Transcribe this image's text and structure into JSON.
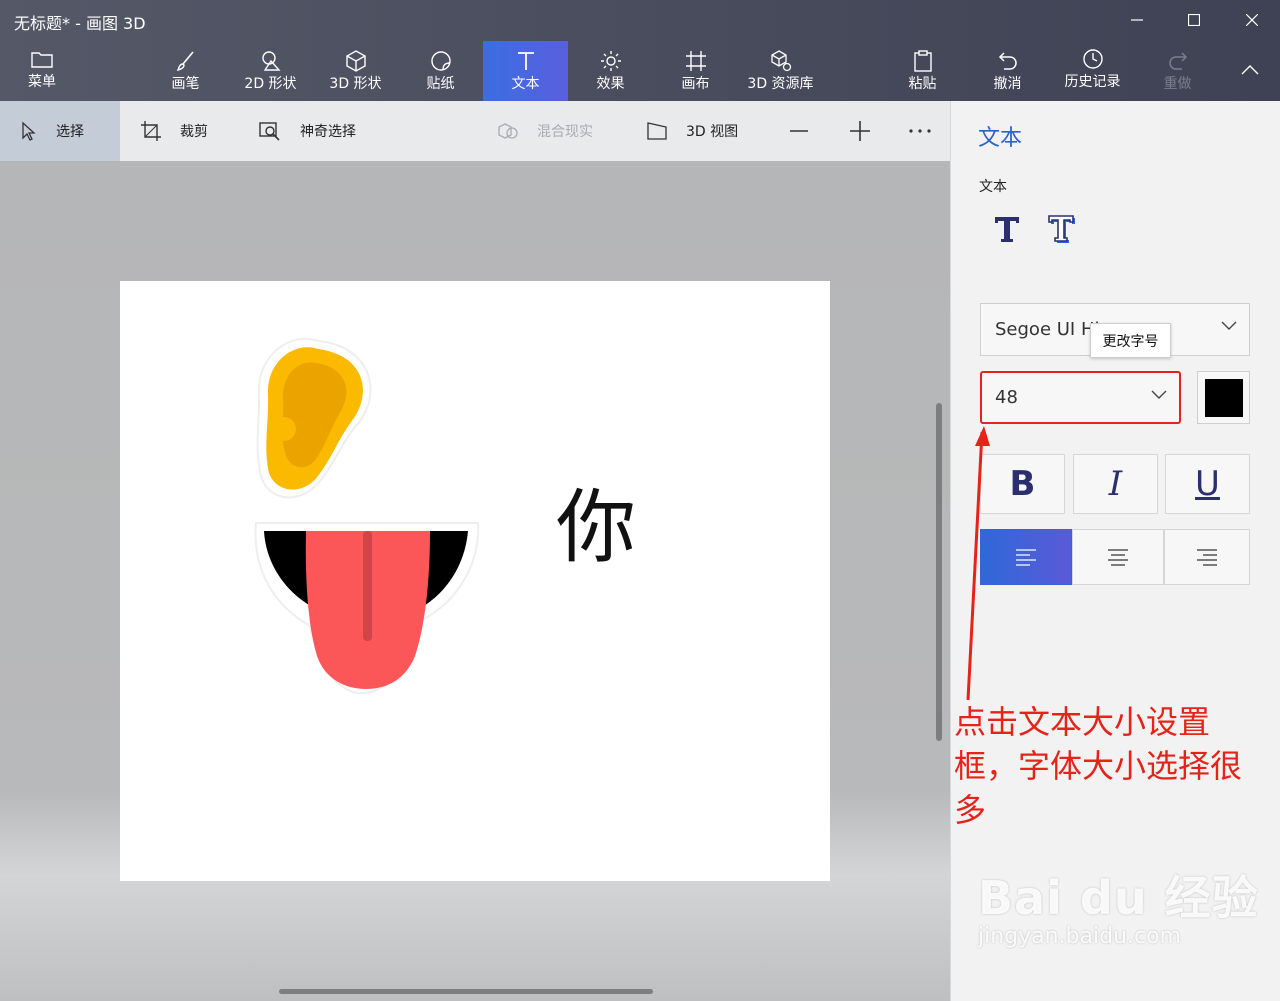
{
  "window": {
    "title": "无标题* - 画图 3D"
  },
  "ribbon": {
    "menu": "菜单",
    "tabs": [
      {
        "label": "画笔",
        "icon": "brush-icon"
      },
      {
        "label": "2D 形状",
        "icon": "2d-shapes-icon"
      },
      {
        "label": "3D 形状",
        "icon": "3d-shapes-icon"
      },
      {
        "label": "贴纸",
        "icon": "stickers-icon"
      },
      {
        "label": "文本",
        "icon": "text-icon",
        "active": true
      },
      {
        "label": "效果",
        "icon": "effects-icon"
      },
      {
        "label": "画布",
        "icon": "canvas-icon"
      },
      {
        "label": "3D 资源库",
        "icon": "3d-library-icon"
      }
    ],
    "actions": [
      {
        "label": "粘贴",
        "icon": "paste-icon"
      },
      {
        "label": "撤消",
        "icon": "undo-icon"
      },
      {
        "label": "历史记录",
        "icon": "history-icon"
      },
      {
        "label": "重做",
        "icon": "redo-icon",
        "disabled": true
      }
    ]
  },
  "toolbar": {
    "select": "选择",
    "crop": "裁剪",
    "magic_select": "神奇选择",
    "mixed_reality": "混合现实",
    "view_3d": "3D 视图"
  },
  "canvas": {
    "text_character": "你"
  },
  "panel": {
    "title": "文本",
    "section_label": "文本",
    "font_name": "Segoe UI Hi",
    "tooltip": "更改字号",
    "font_size": "48",
    "text_color": "#000000",
    "bold": "B",
    "italic": "I",
    "underline": "U"
  },
  "annotation": {
    "text": "点击文本大小设置框，字体大小选择很多"
  },
  "watermark": {
    "logo": "Bai du 经验",
    "url": "jingyan.baidu.com"
  },
  "colors": {
    "accent": "#3a6ee0",
    "annotation": "#e5231b"
  }
}
